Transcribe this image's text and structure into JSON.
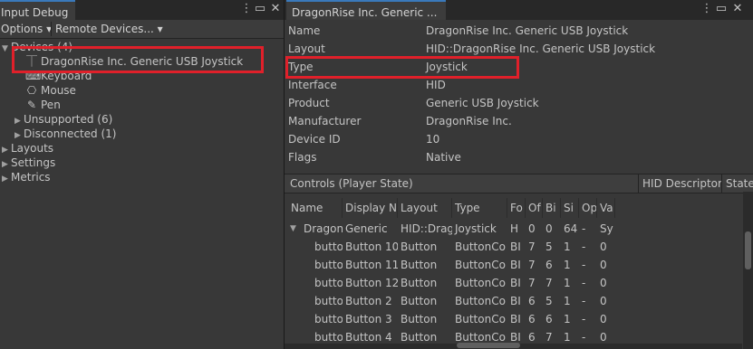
{
  "left": {
    "tab_title": "Input Debug",
    "menu_icon": "kebab-menu-icon",
    "close_icon": "close-icon",
    "toolbar": {
      "options": "Options ▾",
      "remote": "Remote Devices... ▾"
    },
    "tree": {
      "devices": "Devices (4)",
      "items": [
        {
          "label": "DragonRise Inc.   Generic   USB  Joystick",
          "icon": "joystick-icon"
        },
        {
          "label": "Keyboard",
          "icon": "keyboard-icon"
        },
        {
          "label": "Mouse",
          "icon": "mouse-icon"
        },
        {
          "label": "Pen",
          "icon": "pen-icon"
        }
      ],
      "unsupported": "Unsupported (6)",
      "disconnected": "Disconnected (1)",
      "layouts": "Layouts",
      "settings": "Settings",
      "metrics": "Metrics"
    }
  },
  "right": {
    "tab_title": "DragonRise Inc.   Generic ...",
    "properties": [
      {
        "key": "Name",
        "value": "DragonRise Inc.   Generic   USB  Joystick"
      },
      {
        "key": "Layout",
        "value": "HID::DragonRise Inc.   Generic   USB  Joystick"
      },
      {
        "key": "Type",
        "value": "Joystick"
      },
      {
        "key": "Interface",
        "value": "HID"
      },
      {
        "key": "Product",
        "value": "Generic   USB  Joystick"
      },
      {
        "key": "Manufacturer",
        "value": "DragonRise Inc."
      },
      {
        "key": "Device ID",
        "value": "10"
      },
      {
        "key": "Flags",
        "value": "Native"
      }
    ],
    "controls_title": "Controls (Player State)",
    "hid_descriptor": "HID Descriptor",
    "state": "State",
    "columns": [
      "Name",
      "Display N",
      "Layout",
      "Type",
      "Fo",
      "Of",
      "Bi",
      "Si",
      "Op",
      "Va"
    ],
    "rows": [
      [
        "DragonI",
        "Generic",
        "HID::Drag",
        "Joystick",
        "H",
        "0",
        "0",
        "64",
        "-",
        "Sy"
      ],
      [
        "butto",
        "Button 10",
        "Button",
        "ButtonCo",
        "BI",
        "7",
        "5",
        "1",
        "-",
        "0"
      ],
      [
        "butto",
        "Button 11",
        "Button",
        "ButtonCo",
        "BI",
        "7",
        "6",
        "1",
        "-",
        "0"
      ],
      [
        "butto",
        "Button 12",
        "Button",
        "ButtonCo",
        "BI",
        "7",
        "7",
        "1",
        "-",
        "0"
      ],
      [
        "butto",
        "Button 2",
        "Button",
        "ButtonCo",
        "BI",
        "6",
        "5",
        "1",
        "-",
        "0"
      ],
      [
        "butto",
        "Button 3",
        "Button",
        "ButtonCo",
        "BI",
        "6",
        "6",
        "1",
        "-",
        "0"
      ],
      [
        "butto",
        "Button 4",
        "Button",
        "ButtonCo",
        "BI",
        "6",
        "7",
        "1",
        "-",
        "0"
      ]
    ]
  }
}
